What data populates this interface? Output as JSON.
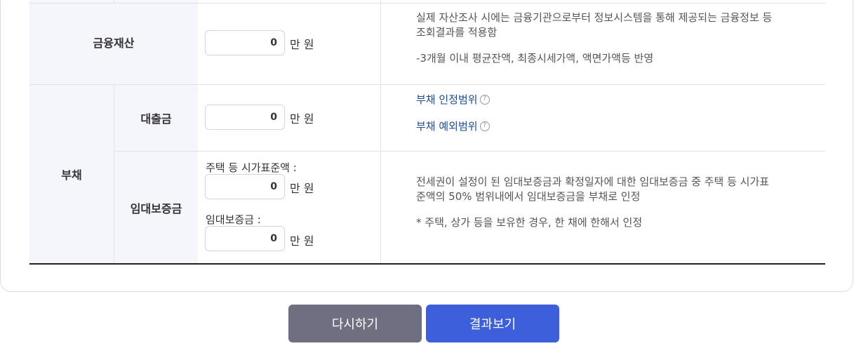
{
  "financial_assets": {
    "header": "금융재산",
    "value": "0",
    "unit": "만 원",
    "desc_line1": "실제 자산조사 시에는 금융기관으로부터 정보시스템을 통해 제공되는 금융정보 등",
    "desc_line2": "조회결과를 적용함",
    "desc_line3": "-3개월 이내 평균잔액, 최종시세가액, 액면가액등 반영"
  },
  "debt": {
    "header": "부채",
    "loan": {
      "header": "대출금",
      "value": "0",
      "unit": "만 원",
      "link1": "부채 인정범위",
      "link2": "부채 예외범위"
    },
    "deposit": {
      "header": "임대보증금",
      "housing_label": "주택 등 시가표준액 :",
      "housing_value": "0",
      "housing_unit": "만 원",
      "deposit_label": "임대보증금 :",
      "deposit_value": "0",
      "deposit_unit": "만 원",
      "desc_line1": "전세권이 설정이 된 임대보증금과 확정일자에 대한 임대보증금 중 주택 등 시가표",
      "desc_line2": "준액의 50% 범위내에서 임대보증금을 부채로 인정",
      "desc_line3": "* 주택, 상가 등을 보유한 경우, 한 채에 한해서 인정"
    }
  },
  "buttons": {
    "reset": "다시하기",
    "result": "결과보기"
  },
  "colors": {
    "reset_bg": "#6e7082",
    "result_bg": "#3d5fd9",
    "header_bg": "#f5f6fb",
    "link": "#1d4b8f"
  }
}
